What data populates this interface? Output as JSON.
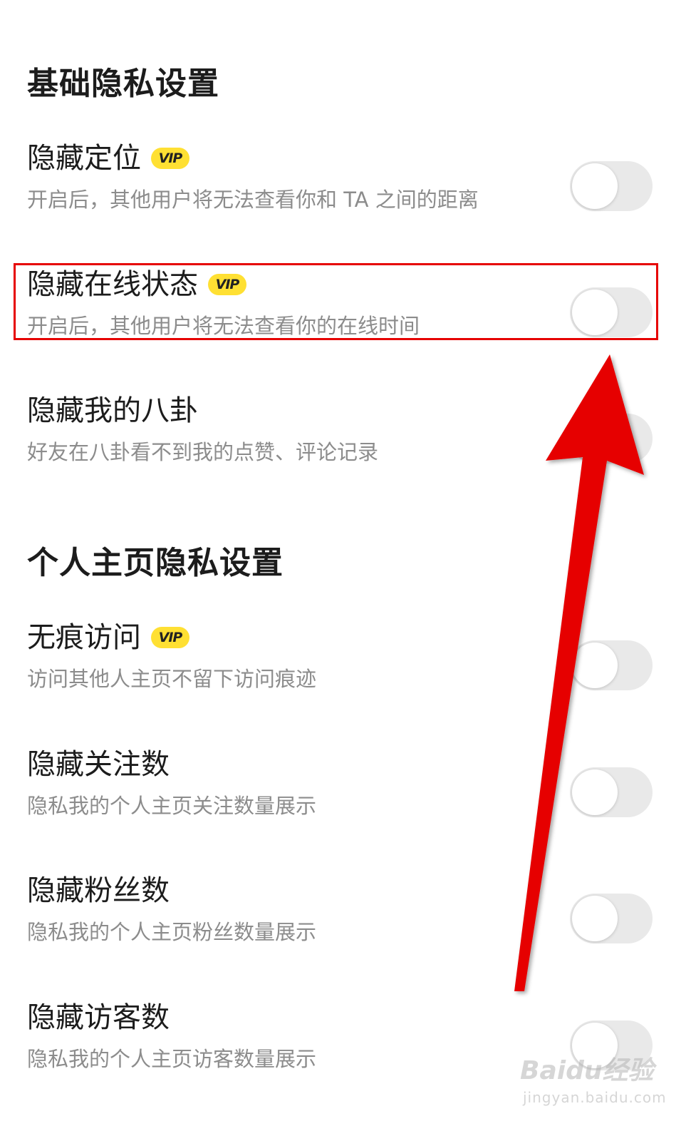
{
  "sections": [
    {
      "title": "基础隐私设置"
    },
    {
      "title": "个人主页隐私设置"
    }
  ],
  "vip_label": "VIP",
  "rows": [
    {
      "title": "隐藏定位",
      "vip": true,
      "desc": "开启后，其他用户将无法查看你和 TA 之间的距离",
      "enabled": false
    },
    {
      "title": "隐藏在线状态",
      "vip": true,
      "desc": "开启后，其他用户将无法查看你的在线时间",
      "enabled": false
    },
    {
      "title": "隐藏我的八卦",
      "vip": false,
      "desc": "好友在八卦看不到我的点赞、评论记录",
      "enabled": false
    },
    {
      "title": "无痕访问",
      "vip": true,
      "desc": "访问其他人主页不留下访问痕迹",
      "enabled": false
    },
    {
      "title": "隐藏关注数",
      "vip": false,
      "desc": "隐私我的个人主页关注数量展示",
      "enabled": false
    },
    {
      "title": "隐藏粉丝数",
      "vip": false,
      "desc": "隐私我的个人主页粉丝数量展示",
      "enabled": false
    },
    {
      "title": "隐藏访客数",
      "vip": false,
      "desc": "隐私我的个人主页访客数量展示",
      "enabled": false
    }
  ],
  "watermark": {
    "main": "Baidu经验",
    "sub": "jingyan.baidu.com"
  },
  "colors": {
    "highlight": "#e60000",
    "vip": "#ffe033",
    "toggle_off": "#e9e9e9"
  }
}
